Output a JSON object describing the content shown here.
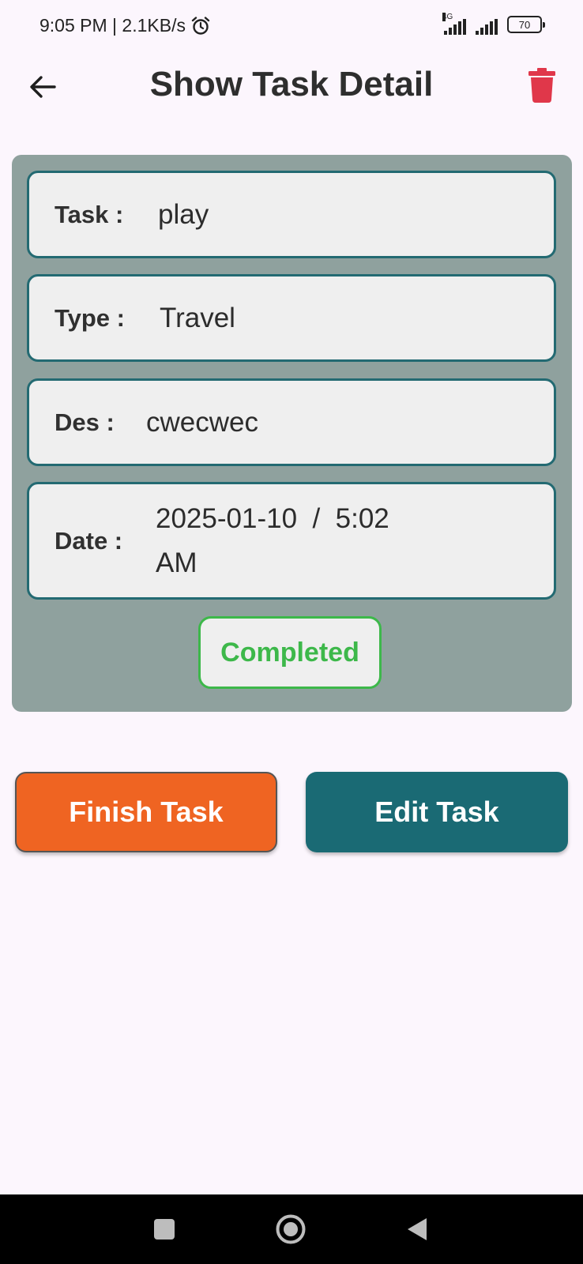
{
  "status_bar": {
    "time_and_speed": "9:05 PM | 2.1KB/s",
    "network_label": "4G",
    "battery": "70"
  },
  "app_bar": {
    "title": "Show Task Detail",
    "back_icon": "arrow-left-icon",
    "delete_icon": "trash-icon",
    "delete_color": "#e0374a"
  },
  "task": {
    "task_label": "Task :",
    "task_value": "play",
    "type_label": "Type :",
    "type_value": "Travel",
    "des_label": "Des :",
    "des_value": "cwecwec",
    "date_label": "Date :",
    "date_line1": "2025-01-10  /  5:02",
    "date_line2": "AM",
    "status": "Completed",
    "status_color": "#3db84a"
  },
  "actions": {
    "finish_label": "Finish Task",
    "edit_label": "Edit Task",
    "finish_color": "#ef6422",
    "edit_color": "#1a6a74"
  },
  "nav_bar": {
    "items": [
      "recents-square-icon",
      "home-circle-icon",
      "back-triangle-icon"
    ]
  }
}
